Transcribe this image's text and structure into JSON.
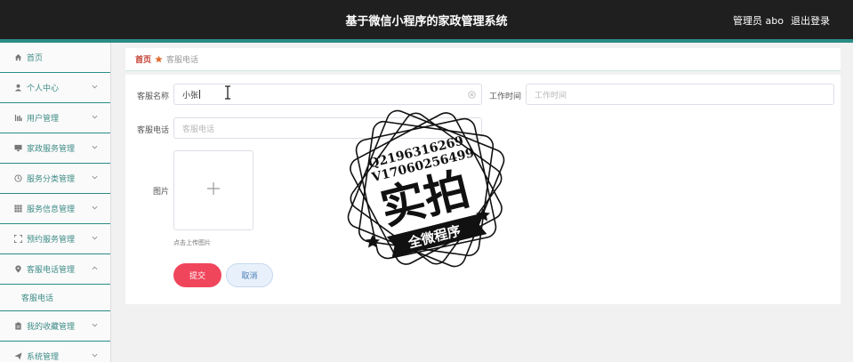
{
  "header": {
    "title": "基于微信小程序的家政管理系统",
    "user_label": "管理员 abo",
    "logout_label": "退出登录"
  },
  "sidebar": {
    "items": [
      {
        "label": "首页",
        "icon": "home-icon",
        "expandable": false
      },
      {
        "label": "个人中心",
        "icon": "user-icon",
        "expandable": true
      },
      {
        "label": "用户管理",
        "icon": "bar-chart-icon",
        "expandable": true
      },
      {
        "label": "家政服务管理",
        "icon": "monitor-icon",
        "expandable": true
      },
      {
        "label": "服务分类管理",
        "icon": "clock-icon",
        "expandable": true
      },
      {
        "label": "服务信息管理",
        "icon": "grid-icon",
        "expandable": true
      },
      {
        "label": "预约服务管理",
        "icon": "frame-icon",
        "expandable": true
      },
      {
        "label": "客服电话管理",
        "icon": "location-pin-icon",
        "expandable": true,
        "expanded": true
      },
      {
        "label": "我的收藏管理",
        "icon": "clipboard-icon",
        "expandable": true
      },
      {
        "label": "系统管理",
        "icon": "send-icon",
        "expandable": true
      }
    ],
    "sub_item": "客服电话"
  },
  "breadcrumb": {
    "home": "首页",
    "current": "客服电话"
  },
  "form": {
    "name_label": "客服名称",
    "name_value": "小张",
    "work_time_label": "工作时间",
    "work_time_placeholder": "工作时间",
    "phone_label": "客服电话",
    "phone_placeholder": "客服电话",
    "image_label": "图片",
    "upload_hint": "点击上传图片",
    "submit_label": "提交",
    "cancel_label": "取消"
  },
  "watermark": {
    "line1": "Q2196316269",
    "line2": "V17060256499",
    "big": "实拍",
    "ribbon": "全微程序"
  },
  "colors": {
    "topbar": "#1f1f1f",
    "accent": "#2a8c86",
    "submit": "#f0465c",
    "cancel": "#e8f1fb"
  }
}
